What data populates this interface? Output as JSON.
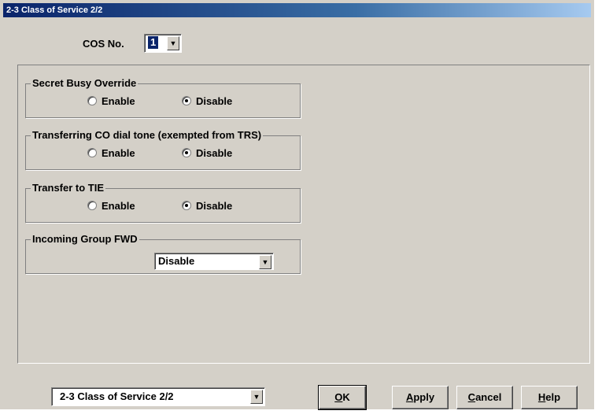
{
  "window": {
    "title": "2-3 Class of Service 2/2"
  },
  "cos": {
    "label": "COS No.",
    "value": "1"
  },
  "groups": [
    {
      "title": "Secret Busy Override",
      "options": [
        "Enable",
        "Disable"
      ],
      "selected": "Disable"
    },
    {
      "title": "Transferring CO dial tone (exempted from TRS)",
      "options": [
        "Enable",
        "Disable"
      ],
      "selected": "Disable"
    },
    {
      "title": "Transfer to TIE",
      "options": [
        "Enable",
        "Disable"
      ],
      "selected": "Disable"
    }
  ],
  "incoming_fwd": {
    "title": "Incoming Group FWD",
    "value": "Disable"
  },
  "footer": {
    "page_select": "2-3 Class of Service 2/2",
    "buttons": [
      {
        "label": "OK",
        "mnemonic": "O",
        "rest": "K"
      },
      {
        "label": "Apply",
        "mnemonic": "A",
        "rest": "pply"
      },
      {
        "label": "Cancel",
        "mnemonic": "C",
        "rest": "ancel"
      },
      {
        "label": "Help",
        "mnemonic": "H",
        "rest": "elp"
      }
    ]
  },
  "colors": {
    "face": "#d4d0c8",
    "title_start": "#0a246a",
    "title_end": "#a6caf0"
  }
}
